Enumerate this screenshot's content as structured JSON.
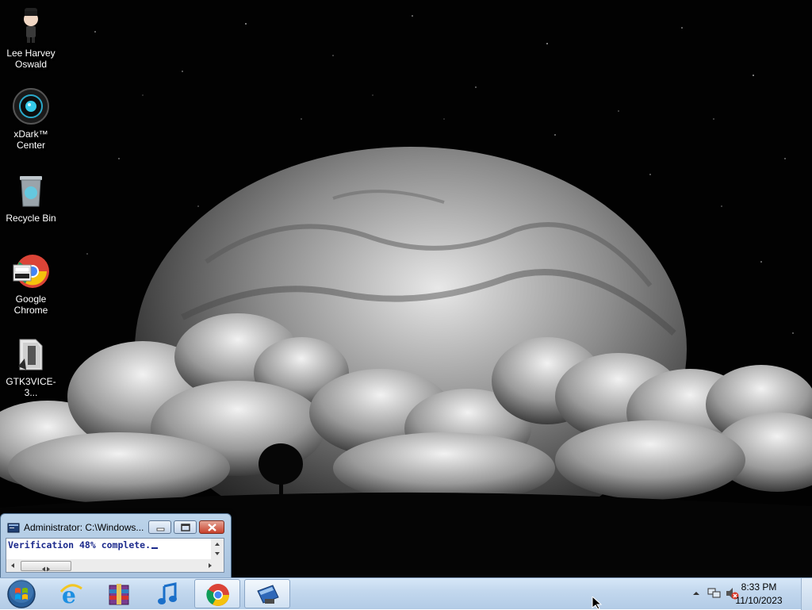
{
  "desktop_icons": [
    {
      "label": "Lee Harvey\nOswald",
      "icon": "character-avatar-icon"
    },
    {
      "label": "xDark™\nCenter",
      "icon": "xdark-center-icon"
    },
    {
      "label": "Recycle Bin",
      "icon": "recycle-bin-icon"
    },
    {
      "label": "Google\nChrome",
      "icon": "chrome-shortcut-icon"
    },
    {
      "label": "GTK3VICE-3...",
      "icon": "folder-icon"
    }
  ],
  "console_window": {
    "title": "Administrator: C:\\Windows...",
    "output_line": "Verification 48% complete."
  },
  "taskbar": {
    "start_icon": "windows-start-orb-icon",
    "pinned": [
      {
        "name": "Internet Explorer",
        "icon": "internet-explorer-icon"
      },
      {
        "name": "WinRAR",
        "icon": "winrar-icon"
      },
      {
        "name": "Music",
        "icon": "music-note-icon"
      },
      {
        "name": "Google Chrome",
        "icon": "chrome-icon"
      },
      {
        "name": "Console Window",
        "icon": "console-window-icon"
      }
    ],
    "tray": {
      "time": "8:33 PM",
      "date": "11/10/2023"
    }
  },
  "colors": {
    "console_text": "#1c2a8c",
    "taskbar_top": "#d7e8f8",
    "taskbar_bottom": "#b2cbe6",
    "close_button": "#c8412b"
  }
}
